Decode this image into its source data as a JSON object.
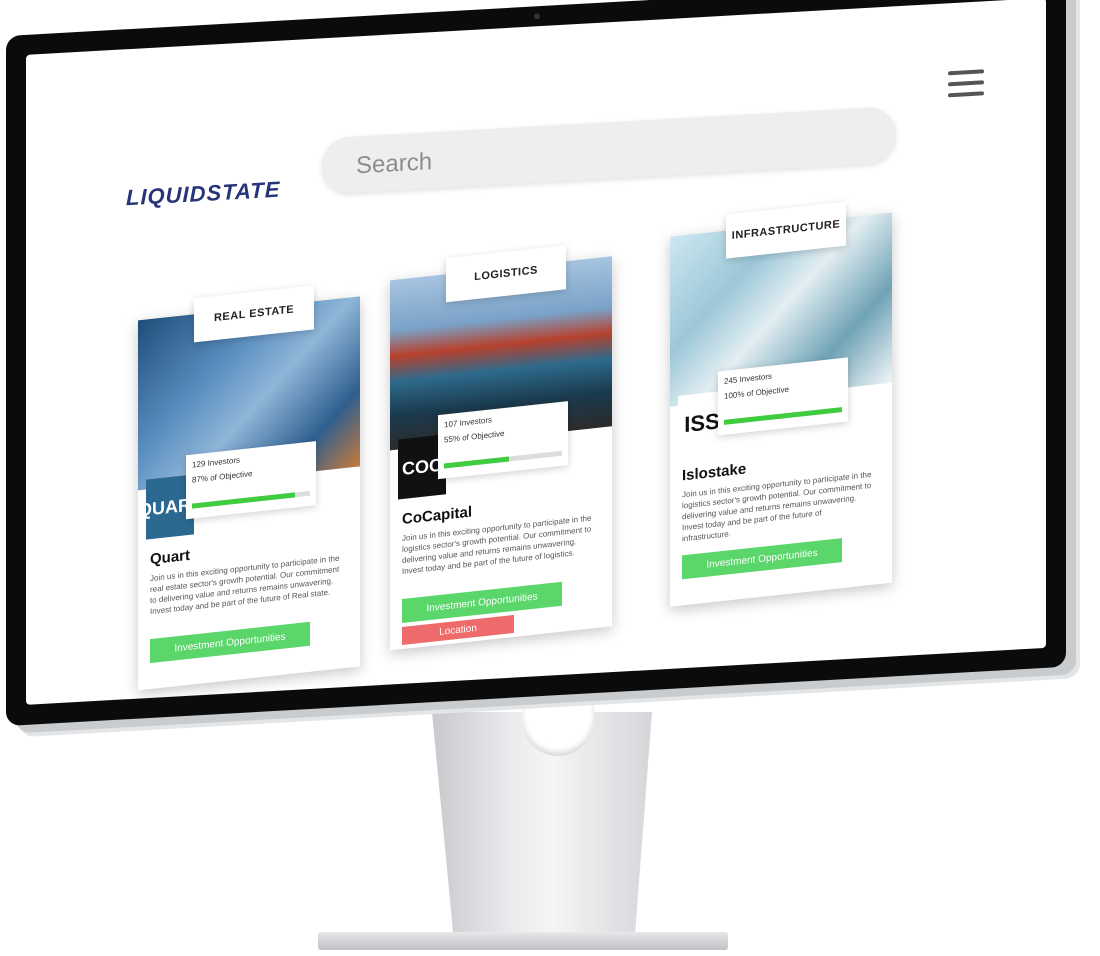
{
  "app": {
    "logo": "LIQUIDSTATE",
    "search_placeholder": "Search"
  },
  "cards": [
    {
      "category": "REAL ESTATE",
      "company_logo": "QUART",
      "investors": "129 Investors",
      "objective": "87% of Objective",
      "progress": 0.87,
      "name": "Quart",
      "description": "Join us in this exciting opportunity to participate in the real estate sector's growth potential. Our commitment to delivering value and returns remains unwavering. Invest today and be part of the future of Real state.",
      "invest_label": "Investment Opportunities"
    },
    {
      "category": "LOGISTICS",
      "company_logo": "COC",
      "investors": "107 Investors",
      "objective": "55% of Objective",
      "progress": 0.55,
      "name": "CoCapital",
      "description": "Join us in this exciting opportunity to participate in the logistics sector's growth potential. Our commitment to delivering value and returns remains unwavering. Invest today and be part of the future of logistics.",
      "invest_label": "Investment Opportunities",
      "location_label": "Location"
    },
    {
      "category": "INFRASTRUCTURE",
      "company_logo": "ISS",
      "investors": "245 Investors",
      "objective": "100% of Objective",
      "progress": 1.0,
      "name": "Islostake",
      "description": "Join us in this exciting opportunity to participate in the logistics sector's growth potential. Our commitment to delivering value and returns remains unwavering. Invest today and be part of the future of infrastructure.",
      "invest_label": "Investment Opportunities"
    }
  ],
  "colors": {
    "brand": "#27347a",
    "progress": "#3fcc3f",
    "invest_button": "#5bd66b",
    "location_button": "#ef6a6a"
  },
  "icons": {
    "menu": "hamburger-menu-icon"
  }
}
